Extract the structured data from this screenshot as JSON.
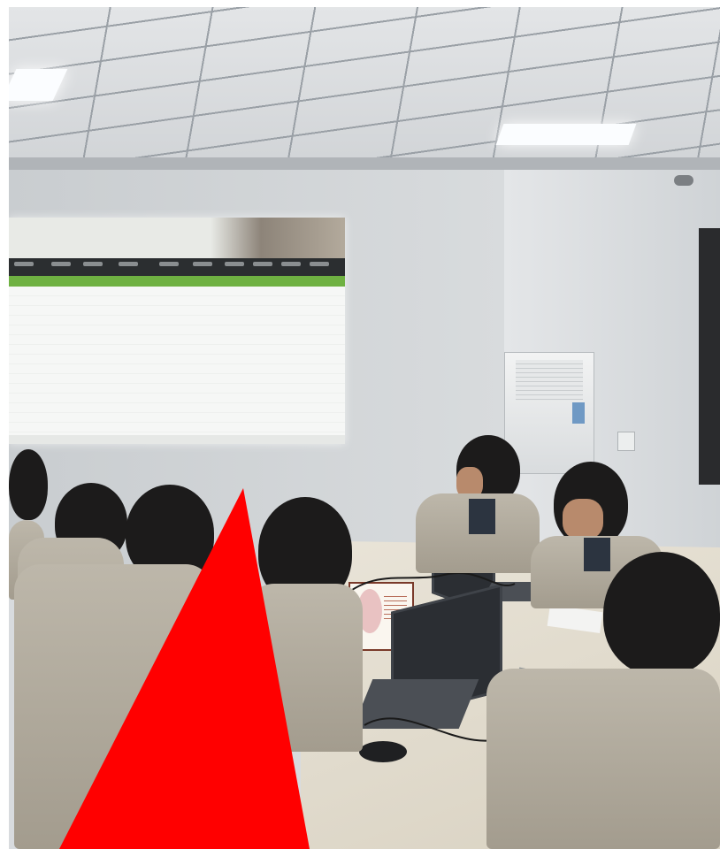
{
  "scene": {
    "overlay_color": "#ff0000",
    "wall_color": "#d8dbde",
    "uniform_color": "#b7b1a3"
  }
}
